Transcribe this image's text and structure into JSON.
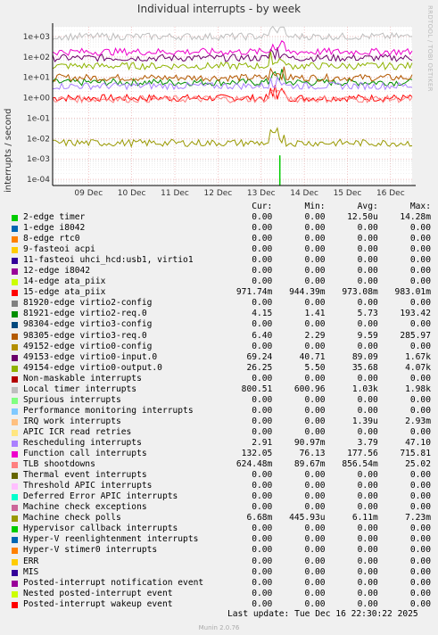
{
  "title": "Individual interrupts - by week",
  "side_text": "RRDTOOL / TOBI OETIKER",
  "footer": {
    "last_update": "Last update: Tue Dec 16 22:30:22 2025",
    "munin": "Munin 2.0.76"
  },
  "colors": {
    "background": "#f0f0f0",
    "plot_bg": "#ffffff",
    "grid_major": "#e8a0a0",
    "grid_minor": "#dddddd"
  },
  "table_header": {
    "cur": "Cur:",
    "min": "Min:",
    "avg": "Avg:",
    "max": "Max:"
  },
  "chart_data": {
    "type": "line",
    "title": "Individual interrupts - by week",
    "ylabel": "interrupts / second",
    "y_scale": "log",
    "ylim": [
      5e-05,
      3000
    ],
    "y_ticks": [
      {
        "v": 1000,
        "label": "1e+03"
      },
      {
        "v": 100,
        "label": "1e+02"
      },
      {
        "v": 10,
        "label": "1e+01"
      },
      {
        "v": 1,
        "label": "1e+00"
      },
      {
        "v": 0.1,
        "label": "1e-01"
      },
      {
        "v": 0.01,
        "label": "1e-02"
      },
      {
        "v": 0.001,
        "label": "1e-03"
      },
      {
        "v": 0.0001,
        "label": "1e-04"
      }
    ],
    "x_ticks": [
      "09 Dec",
      "10 Dec",
      "11 Dec",
      "12 Dec",
      "13 Dec",
      "14 Dec",
      "15 Dec",
      "16 Dec"
    ],
    "xlim": [
      "2025-12-08 09:00",
      "2025-12-16 22:30"
    ],
    "grid": true,
    "series": [
      {
        "name": "2-edge timer",
        "color": "#00cc00",
        "cur": "0.00",
        "min": "0.00",
        "avg": "12.50u",
        "max": "14.28m",
        "approx_level": 0
      },
      {
        "name": "1-edge i8042",
        "color": "#0066b3",
        "cur": "0.00",
        "min": "0.00",
        "avg": "0.00",
        "max": "0.00",
        "approx_level": 0
      },
      {
        "name": "8-edge rtc0",
        "color": "#ff8000",
        "cur": "0.00",
        "min": "0.00",
        "avg": "0.00",
        "max": "0.00",
        "approx_level": 0
      },
      {
        "name": "9-fasteoi acpi",
        "color": "#ffcc00",
        "cur": "0.00",
        "min": "0.00",
        "avg": "0.00",
        "max": "0.00",
        "approx_level": 0
      },
      {
        "name": "11-fasteoi uhci_hcd:usb1, virtio1",
        "color": "#330099",
        "cur": "0.00",
        "min": "0.00",
        "avg": "0.00",
        "max": "0.00",
        "approx_level": 0
      },
      {
        "name": "12-edge i8042",
        "color": "#990099",
        "cur": "0.00",
        "min": "0.00",
        "avg": "0.00",
        "max": "0.00",
        "approx_level": 0
      },
      {
        "name": "14-edge ata_piix",
        "color": "#ccff00",
        "cur": "0.00",
        "min": "0.00",
        "avg": "0.00",
        "max": "0.00",
        "approx_level": 0
      },
      {
        "name": "15-edge ata_piix",
        "color": "#ff0000",
        "cur": "971.74m",
        "min": "944.39m",
        "avg": "973.08m",
        "max": "983.01m",
        "approx_level": 0.97
      },
      {
        "name": "81920-edge virtio2-config",
        "color": "#808080",
        "cur": "0.00",
        "min": "0.00",
        "avg": "0.00",
        "max": "0.00",
        "approx_level": 0
      },
      {
        "name": "81921-edge virtio2-req.0",
        "color": "#008f00",
        "cur": "4.15",
        "min": "1.41",
        "avg": "5.73",
        "max": "193.42",
        "approx_level": 5.7
      },
      {
        "name": "98304-edge virtio3-config",
        "color": "#00487d",
        "cur": "0.00",
        "min": "0.00",
        "avg": "0.00",
        "max": "0.00",
        "approx_level": 0
      },
      {
        "name": "98305-edge virtio3-req.0",
        "color": "#b35a00",
        "cur": "6.40",
        "min": "2.29",
        "avg": "9.59",
        "max": "285.97",
        "approx_level": 9.6
      },
      {
        "name": "49152-edge virtio0-config",
        "color": "#b38f00",
        "cur": "0.00",
        "min": "0.00",
        "avg": "0.00",
        "max": "0.00",
        "approx_level": 0
      },
      {
        "name": "49153-edge virtio0-input.0",
        "color": "#6b006b",
        "cur": "69.24",
        "min": "40.71",
        "avg": "89.09",
        "max": "1.67k",
        "approx_level": 89
      },
      {
        "name": "49154-edge virtio0-output.0",
        "color": "#8fb300",
        "cur": "26.25",
        "min": "5.50",
        "avg": "35.68",
        "max": "4.07k",
        "approx_level": 36
      },
      {
        "name": "Non-maskable interrupts",
        "color": "#b30000",
        "cur": "0.00",
        "min": "0.00",
        "avg": "0.00",
        "max": "0.00",
        "approx_level": 0
      },
      {
        "name": "Local timer interrupts",
        "color": "#bebebe",
        "cur": "800.51",
        "min": "600.96",
        "avg": "1.03k",
        "max": "1.98k",
        "approx_level": 1000
      },
      {
        "name": "Spurious interrupts",
        "color": "#80ff80",
        "cur": "0.00",
        "min": "0.00",
        "avg": "0.00",
        "max": "0.00",
        "approx_level": 0
      },
      {
        "name": "Performance monitoring interrupts",
        "color": "#80c9ff",
        "cur": "0.00",
        "min": "0.00",
        "avg": "0.00",
        "max": "0.00",
        "approx_level": 0
      },
      {
        "name": "IRQ work interrupts",
        "color": "#ffc080",
        "cur": "0.00",
        "min": "0.00",
        "avg": "1.39u",
        "max": "2.93m",
        "approx_level": 0
      },
      {
        "name": "APIC ICR read retries",
        "color": "#ffe680",
        "cur": "0.00",
        "min": "0.00",
        "avg": "0.00",
        "max": "0.00",
        "approx_level": 0
      },
      {
        "name": "Rescheduling interrupts",
        "color": "#aa80ff",
        "cur": "2.91",
        "min": "90.97m",
        "avg": "3.79",
        "max": "47.10",
        "approx_level": 3.8
      },
      {
        "name": "Function call interrupts",
        "color": "#ee00cc",
        "cur": "132.05",
        "min": "76.13",
        "avg": "177.56",
        "max": "715.81",
        "approx_level": 178
      },
      {
        "name": "TLB shootdowns",
        "color": "#ff8080",
        "cur": "624.48m",
        "min": "89.67m",
        "avg": "856.54m",
        "max": "25.02",
        "approx_level": 0.86
      },
      {
        "name": "Thermal event interrupts",
        "color": "#666600",
        "cur": "0.00",
        "min": "0.00",
        "avg": "0.00",
        "max": "0.00",
        "approx_level": 0
      },
      {
        "name": "Threshold APIC interrupts",
        "color": "#ffbfff",
        "cur": "0.00",
        "min": "0.00",
        "avg": "0.00",
        "max": "0.00",
        "approx_level": 0
      },
      {
        "name": "Deferred Error APIC interrupts",
        "color": "#00ffcc",
        "cur": "0.00",
        "min": "0.00",
        "avg": "0.00",
        "max": "0.00",
        "approx_level": 0
      },
      {
        "name": "Machine check exceptions",
        "color": "#cc6699",
        "cur": "0.00",
        "min": "0.00",
        "avg": "0.00",
        "max": "0.00",
        "approx_level": 0
      },
      {
        "name": "Machine check polls",
        "color": "#999900",
        "cur": "6.68m",
        "min": "445.93u",
        "avg": "6.11m",
        "max": "7.23m",
        "approx_level": 0.0061
      },
      {
        "name": "Hypervisor callback interrupts",
        "color": "#00cc00",
        "cur": "0.00",
        "min": "0.00",
        "avg": "0.00",
        "max": "0.00",
        "approx_level": 0
      },
      {
        "name": "Hyper-V reenlightenment interrupts",
        "color": "#0066b3",
        "cur": "0.00",
        "min": "0.00",
        "avg": "0.00",
        "max": "0.00",
        "approx_level": 0
      },
      {
        "name": "Hyper-V stimer0 interrupts",
        "color": "#ff8000",
        "cur": "0.00",
        "min": "0.00",
        "avg": "0.00",
        "max": "0.00",
        "approx_level": 0
      },
      {
        "name": "ERR",
        "color": "#ffcc00",
        "cur": "0.00",
        "min": "0.00",
        "avg": "0.00",
        "max": "0.00",
        "approx_level": 0
      },
      {
        "name": "MIS",
        "color": "#330099",
        "cur": "0.00",
        "min": "0.00",
        "avg": "0.00",
        "max": "0.00",
        "approx_level": 0
      },
      {
        "name": "Posted-interrupt notification event",
        "color": "#990099",
        "cur": "0.00",
        "min": "0.00",
        "avg": "0.00",
        "max": "0.00",
        "approx_level": 0
      },
      {
        "name": "Nested posted-interrupt event",
        "color": "#ccff00",
        "cur": "0.00",
        "min": "0.00",
        "avg": "0.00",
        "max": "0.00",
        "approx_level": 0
      },
      {
        "name": "Posted-interrupt wakeup event",
        "color": "#ff0000",
        "cur": "0.00",
        "min": "0.00",
        "avg": "0.00",
        "max": "0.00",
        "approx_level": 0
      }
    ]
  }
}
